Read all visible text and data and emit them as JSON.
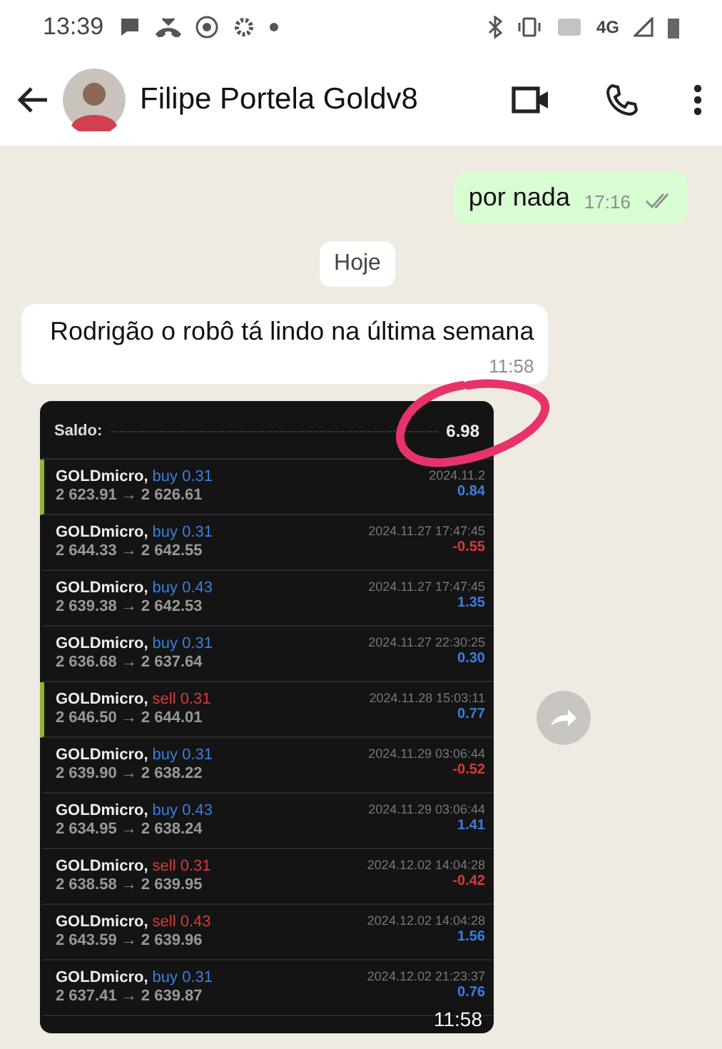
{
  "status_bar": {
    "time": "13:39",
    "network": "4G"
  },
  "header": {
    "contact_name": "Filipe Portela Goldv8"
  },
  "messages": [
    {
      "kind": "outgoing",
      "text": "por nada",
      "time": "17:16",
      "read": true
    },
    {
      "kind": "date",
      "text": "Hoje"
    },
    {
      "kind": "incoming",
      "text": "Rodrigão o robô tá lindo na última semana",
      "time": "11:58"
    }
  ],
  "image_message": {
    "time": "11:58",
    "balance_label": "Saldo:",
    "balance_value": "6.98",
    "trades": [
      {
        "symbol": "GOLDmicro,",
        "kind": "buy",
        "order": "buy 0.31",
        "prices": "2 623.91 → 2 626.61",
        "date": "2024.11.2",
        "profit": "0.84",
        "loss": false,
        "marked": true
      },
      {
        "symbol": "GOLDmicro,",
        "kind": "buy",
        "order": "buy 0.31",
        "prices": "2 644.33 → 2 642.55",
        "date": "2024.11.27 17:47:45",
        "profit": "-0.55",
        "loss": true,
        "marked": false
      },
      {
        "symbol": "GOLDmicro,",
        "kind": "buy",
        "order": "buy 0.43",
        "prices": "2 639.38 → 2 642.53",
        "date": "2024.11.27 17:47:45",
        "profit": "1.35",
        "loss": false,
        "marked": false
      },
      {
        "symbol": "GOLDmicro,",
        "kind": "buy",
        "order": "buy 0.31",
        "prices": "2 636.68 → 2 637.64",
        "date": "2024.11.27 22:30:25",
        "profit": "0.30",
        "loss": false,
        "marked": false
      },
      {
        "symbol": "GOLDmicro,",
        "kind": "sell",
        "order": "sell 0.31",
        "prices": "2 646.50 → 2 644.01",
        "date": "2024.11.28 15:03:11",
        "profit": "0.77",
        "loss": false,
        "marked": true
      },
      {
        "symbol": "GOLDmicro,",
        "kind": "buy",
        "order": "buy 0.31",
        "prices": "2 639.90 → 2 638.22",
        "date": "2024.11.29 03:06:44",
        "profit": "-0.52",
        "loss": true,
        "marked": false
      },
      {
        "symbol": "GOLDmicro,",
        "kind": "buy",
        "order": "buy 0.43",
        "prices": "2 634.95 → 2 638.24",
        "date": "2024.11.29 03:06:44",
        "profit": "1.41",
        "loss": false,
        "marked": false
      },
      {
        "symbol": "GOLDmicro,",
        "kind": "sell",
        "order": "sell 0.31",
        "prices": "2 638.58 → 2 639.95",
        "date": "2024.12.02 14:04:28",
        "profit": "-0.42",
        "loss": true,
        "marked": false
      },
      {
        "symbol": "GOLDmicro,",
        "kind": "sell",
        "order": "sell 0.43",
        "prices": "2 643.59 → 2 639.96",
        "date": "2024.12.02 14:04:28",
        "profit": "1.56",
        "loss": false,
        "marked": false
      },
      {
        "symbol": "GOLDmicro,",
        "kind": "buy",
        "order": "buy 0.31",
        "prices": "2 637.41 → 2 639.87",
        "date": "2024.12.02 21:23:37",
        "profit": "0.76",
        "loss": false,
        "marked": false
      }
    ]
  }
}
